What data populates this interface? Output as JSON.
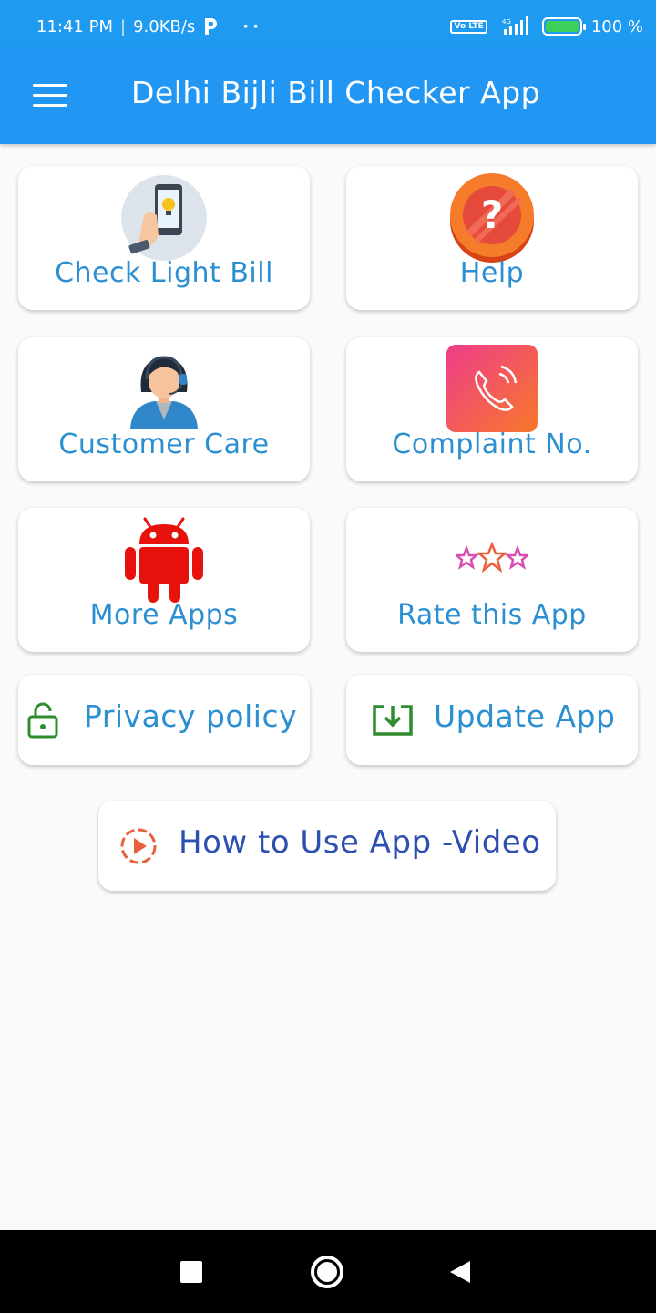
{
  "status": {
    "time": "11:41 PM",
    "speed": "9.0KB/s",
    "dots": "··",
    "network_badge": "Vo LTE",
    "signal_label": "4G",
    "battery": "100 %"
  },
  "app_bar": {
    "title": "Delhi Bijli Bill Checker App"
  },
  "grid": {
    "check_light_bill": "Check Light Bill",
    "help": "Help",
    "customer_care": "Customer Care",
    "complaint_no": "Complaint No.",
    "more_apps": "More Apps",
    "rate_this_app": "Rate this App",
    "privacy_policy": "Privacy policy",
    "update_app": "Update App"
  },
  "video": {
    "label": "How to Use App -Video"
  },
  "colors": {
    "app_bar": "#2196f3",
    "status_bar": "#1e9af0",
    "label_blue": "#2b8fd1",
    "video_label": "#2d4fb0",
    "android_red": "#e8120c",
    "green_icon": "#2e8b2e"
  }
}
